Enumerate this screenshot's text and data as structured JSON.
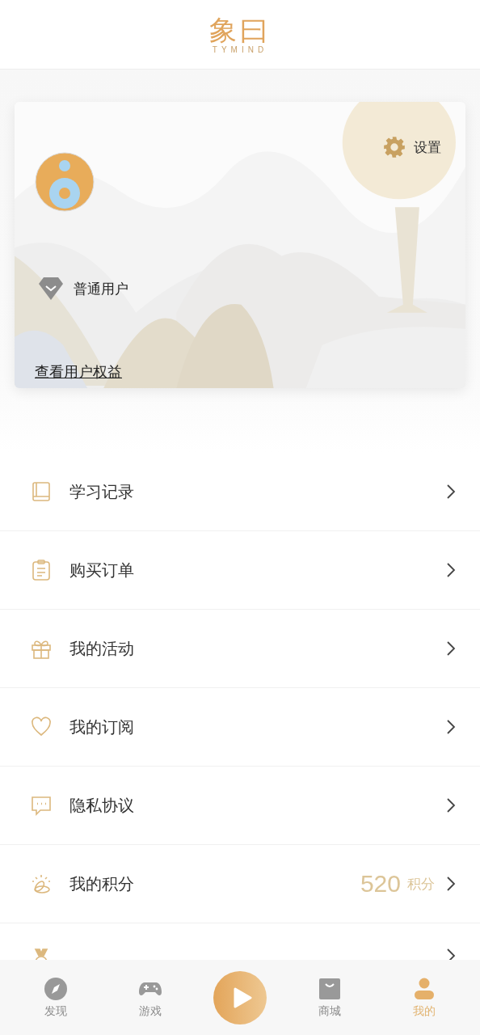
{
  "header": {
    "logo_text": "象曰",
    "logo_subtitle": "TYMIND"
  },
  "profile": {
    "settings_label": "设置",
    "membership": "普通用户",
    "benefits_link": "查看用户权益"
  },
  "menu": [
    {
      "label": "学习记录"
    },
    {
      "label": "购买订单"
    },
    {
      "label": "我的活动"
    },
    {
      "label": "我的订阅"
    },
    {
      "label": "隐私协议"
    },
    {
      "label": "我的积分",
      "value": "520",
      "unit": "积分"
    },
    {
      "kind": "cut"
    }
  ],
  "nav": [
    {
      "kind": "tab",
      "label": "发现",
      "selected": false
    },
    {
      "kind": "tab",
      "label": "游戏",
      "selected": false
    },
    {
      "kind": "play"
    },
    {
      "kind": "tab",
      "label": "商城",
      "selected": false
    },
    {
      "kind": "tab",
      "label": "我的",
      "selected": true
    }
  ]
}
